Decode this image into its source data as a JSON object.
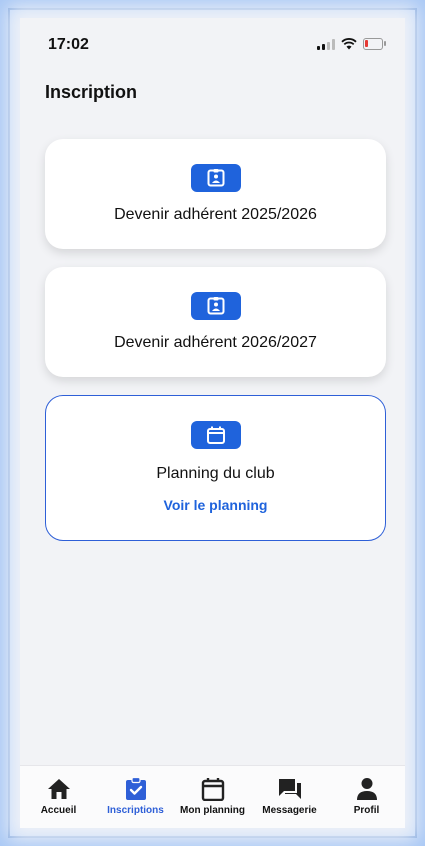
{
  "status_bar": {
    "time": "17:02"
  },
  "page": {
    "title": "Inscription"
  },
  "cards": [
    {
      "label": "Devenir adhérent 2025/2026",
      "icon": "badge-icon"
    },
    {
      "label": "Devenir adhérent 2026/2027",
      "icon": "badge-icon"
    },
    {
      "label": "Planning du club",
      "icon": "calendar-icon",
      "link": "Voir le planning"
    }
  ],
  "tabbar": {
    "active": "Inscriptions",
    "items": [
      {
        "label": "Accueil",
        "icon": "home-icon"
      },
      {
        "label": "Inscriptions",
        "icon": "clipboard-check-icon"
      },
      {
        "label": "Mon planning",
        "icon": "calendar-icon"
      },
      {
        "label": "Messagerie",
        "icon": "chat-icon"
      },
      {
        "label": "Profil",
        "icon": "person-icon"
      }
    ]
  },
  "colors": {
    "accent": "#1f63dc",
    "background": "#f2f3f6",
    "battery_low": "#e53935"
  }
}
